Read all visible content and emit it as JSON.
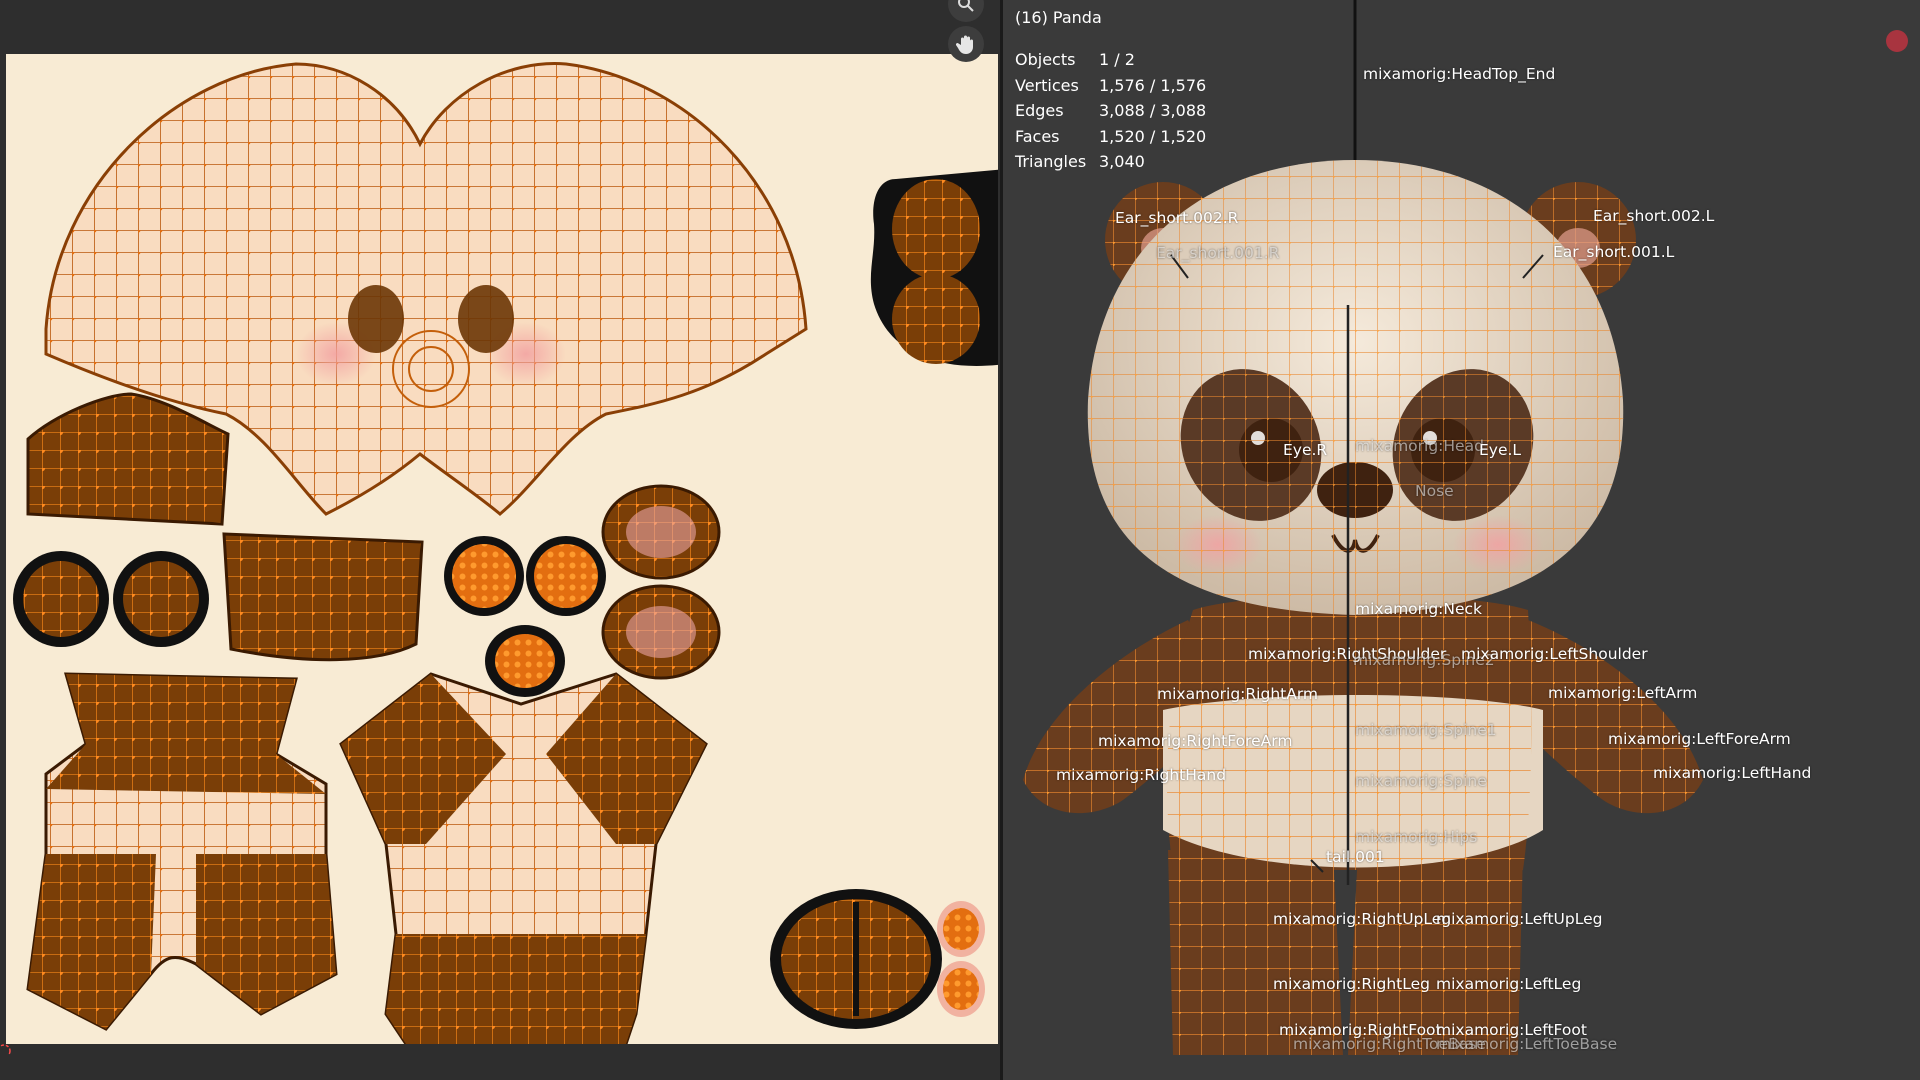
{
  "viewport": {
    "object_title": "(16) Panda",
    "stats": [
      {
        "label": "Objects",
        "value": "1 / 2"
      },
      {
        "label": "Vertices",
        "value": "1,576 / 1,576"
      },
      {
        "label": "Edges",
        "value": "3,088 / 3,088"
      },
      {
        "label": "Faces",
        "value": "1,520 / 1,520"
      },
      {
        "label": "Triangles",
        "value": "3,040"
      }
    ],
    "bones": {
      "head_top_end": "mixamorig:HeadTop_End",
      "ear_short_002_r": "Ear_short.002.R",
      "ear_short_001_r": "Ear_short.001.R",
      "ear_short_002_l": "Ear_short.002.L",
      "ear_short_001_l": "Ear_short.001.L",
      "eye_r": "Eye.R",
      "head": "mixamorig:Head",
      "eye_l": "Eye.L",
      "nose": "Nose",
      "neck": "mixamorig:Neck",
      "right_shoulder": "mixamorig:RightShoulder",
      "spine2": "mixamorig:Spine2",
      "left_shoulder": "mixamorig:LeftShoulder",
      "right_arm": "mixamorig:RightArm",
      "left_arm": "mixamorig:LeftArm",
      "spine1": "mixamorig:Spine1",
      "right_forearm": "mixamorig:RightForeArm",
      "left_forearm": "mixamorig:LeftForeArm",
      "right_hand": "mixamorig:RightHand",
      "left_hand": "mixamorig:LeftHand",
      "spine": "mixamorig:Spine",
      "hips": "mixamorig:Hips",
      "tail_001": "tail.001",
      "right_up_leg": "mixamorig:RightUpLeg",
      "left_up_leg": "mixamorig:LeftUpLeg",
      "right_leg": "mixamorig:RightLeg",
      "left_leg": "mixamorig:LeftLeg",
      "right_foot": "mixamorig:RightFoot",
      "left_foot": "mixamorig:LeftFoot",
      "right_toe_base": "mixamorig:RightToeBase",
      "left_toe_base": "mixamorig:LeftToeBase"
    }
  },
  "icons": {
    "zoom": "zoom-icon",
    "pan": "hand-pan-icon",
    "record": "record-dot-icon",
    "cursor": "2d-cursor-icon"
  },
  "colors": {
    "uv_background": "#f8ebd4",
    "uv_wire": "#c45f0a",
    "uv_vertex": "#ff8a1f",
    "uv_dark_fill": "#7a3e07",
    "uv_light_fill": "#f9dcc0",
    "viewport_bg": "#3a3a3a"
  }
}
